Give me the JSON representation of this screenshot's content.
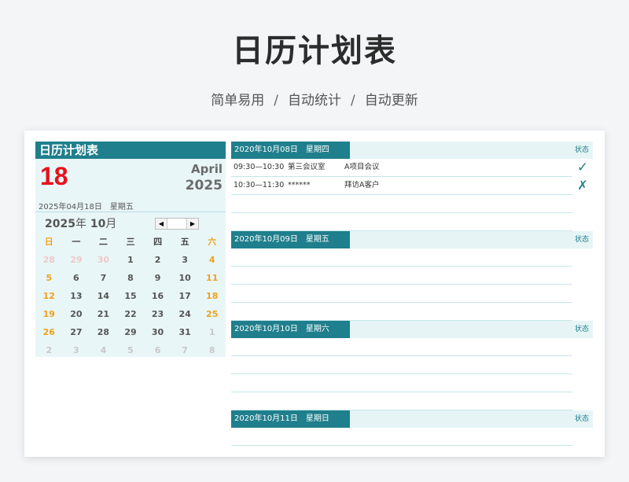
{
  "hero": {
    "title": "日历计划表",
    "features": [
      "简单易用",
      "自动统计",
      "自动更新"
    ],
    "separator": "/"
  },
  "left": {
    "title": "日历计划表",
    "day": "18",
    "month_en": "April",
    "year": "2025",
    "date_line": "2025年04月18日　星期五",
    "cal_year": "2025",
    "cal_year_unit": "年",
    "cal_month": "10",
    "cal_month_unit": "月",
    "nav_prev": "◀",
    "nav_next": "▶",
    "weekdays": [
      "日",
      "一",
      "二",
      "三",
      "四",
      "五",
      "六"
    ],
    "weeks": [
      [
        "28",
        "29",
        "30",
        "1",
        "2",
        "3",
        "4"
      ],
      [
        "5",
        "6",
        "7",
        "8",
        "9",
        "10",
        "11"
      ],
      [
        "12",
        "13",
        "14",
        "15",
        "16",
        "17",
        "18"
      ],
      [
        "19",
        "20",
        "21",
        "22",
        "23",
        "24",
        "25"
      ],
      [
        "26",
        "27",
        "28",
        "29",
        "30",
        "31",
        "1"
      ],
      [
        "2",
        "3",
        "4",
        "5",
        "6",
        "7",
        "8"
      ]
    ]
  },
  "days": [
    {
      "date": "2020年10月08日",
      "weekday": "星期四",
      "status_label": "状态",
      "events": [
        {
          "time": "09:30—10:30",
          "location": "第三会议室",
          "event": "A项目会议",
          "status": "✓"
        },
        {
          "time": "10:30—11:30",
          "location": "******",
          "event": "拜访A客户",
          "status": "✗"
        },
        {
          "time": "",
          "location": "",
          "event": "",
          "status": ""
        },
        {
          "time": "",
          "location": "",
          "event": "",
          "status": ""
        }
      ]
    },
    {
      "date": "2020年10月09日",
      "weekday": "星期五",
      "status_label": "状态",
      "events": [
        {
          "time": "",
          "location": "",
          "event": "",
          "status": ""
        },
        {
          "time": "",
          "location": "",
          "event": "",
          "status": ""
        },
        {
          "time": "",
          "location": "",
          "event": "",
          "status": ""
        },
        {
          "time": "",
          "location": "",
          "event": "",
          "status": ""
        }
      ]
    },
    {
      "date": "2020年10月10日",
      "weekday": "星期六",
      "status_label": "状态",
      "events": [
        {
          "time": "",
          "location": "",
          "event": "",
          "status": ""
        },
        {
          "time": "",
          "location": "",
          "event": "",
          "status": ""
        },
        {
          "time": "",
          "location": "",
          "event": "",
          "status": ""
        },
        {
          "time": "",
          "location": "",
          "event": "",
          "status": ""
        }
      ]
    },
    {
      "date": "2020年10月11日",
      "weekday": "星期日",
      "status_label": "状态",
      "events": [
        {
          "time": "",
          "location": "",
          "event": "",
          "status": ""
        }
      ]
    }
  ],
  "colors": {
    "accent": "#1f7f8c",
    "today_red": "#e8111b",
    "weekend": "#f0a21a",
    "panel_bg": "#e9f6f8"
  }
}
